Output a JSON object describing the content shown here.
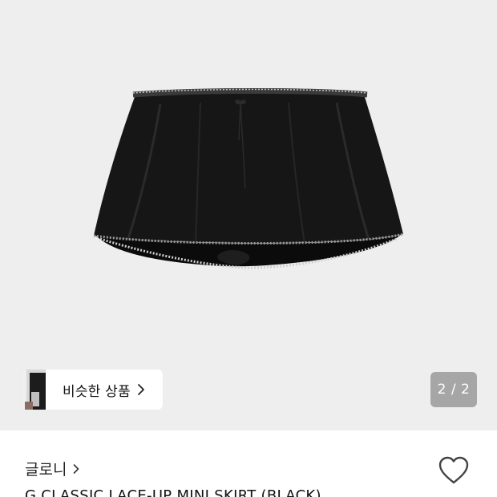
{
  "gallery": {
    "image_icon": "black-mini-skirt-photo",
    "background_color": "#eeeeee",
    "counter": "2 / 2",
    "similar": {
      "label": "비슷한 상품",
      "thumb_icon": "similar-product-thumbnail",
      "chevron_icon": "chevron-right-icon"
    }
  },
  "product": {
    "brand": "글로니",
    "brand_chevron_icon": "chevron-right-icon",
    "title": "G CLASSIC LACE-UP MINI SKIRT (BLACK)",
    "wishlist_icon": "heart-outline-icon"
  }
}
